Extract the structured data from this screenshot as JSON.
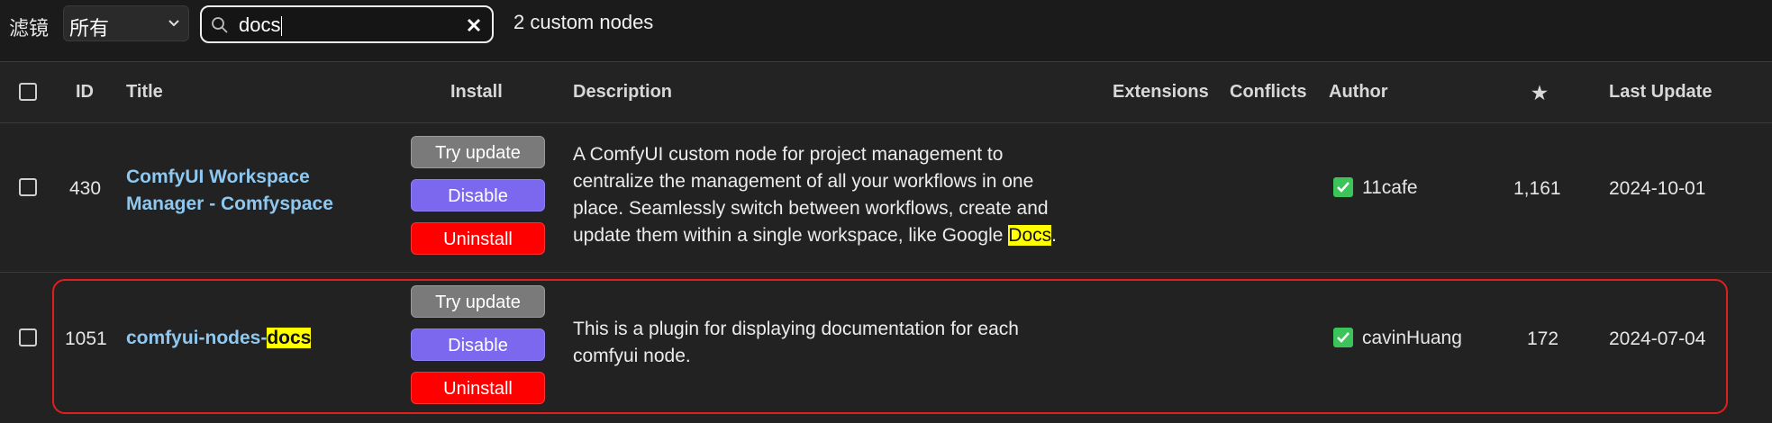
{
  "filter": {
    "label": "滤镜",
    "selected": "所有"
  },
  "search": {
    "value": "docs",
    "clear_icon": "close-icon",
    "search_icon": "search-icon"
  },
  "result_count": "2 custom nodes",
  "columns": {
    "id": "ID",
    "title": "Title",
    "install": "Install",
    "description": "Description",
    "extensions": "Extensions",
    "conflicts": "Conflicts",
    "author": "Author",
    "stars": "★",
    "last_update": "Last Update"
  },
  "rows": [
    {
      "id": "430",
      "title_line1": "ComfyUI Workspace",
      "title_line2": "Manager - Comfyspace",
      "buttons": {
        "try": "Try update",
        "disable": "Disable",
        "uninstall": "Uninstall"
      },
      "desc_l1": "A ComfyUI custom node for project management to",
      "desc_l2": "centralize the management of all your workflows in one",
      "desc_l3": "place. Seamlessly switch between workflows, create and",
      "desc_l4_pre": "update them within a single workspace, like Google ",
      "desc_l4_hl": "Docs",
      "desc_l4_post": ".",
      "author": "11cafe",
      "stars": "1,161",
      "last_update": "2024-10-01"
    },
    {
      "id": "1051",
      "title_pre": "comfyui-nodes-",
      "title_hl": "docs",
      "buttons": {
        "try": "Try update",
        "disable": "Disable",
        "uninstall": "Uninstall"
      },
      "desc_l1": "This is a plugin for displaying documentation for each",
      "desc_l2": "comfyui node.",
      "author": "cavinHuang",
      "stars": "172",
      "last_update": "2024-07-04"
    }
  ],
  "colors": {
    "accent_highlight": "#ffff00",
    "disable_btn": "#7b68ee",
    "uninstall_btn": "#ff0000",
    "selection_border": "#e01e1e"
  }
}
